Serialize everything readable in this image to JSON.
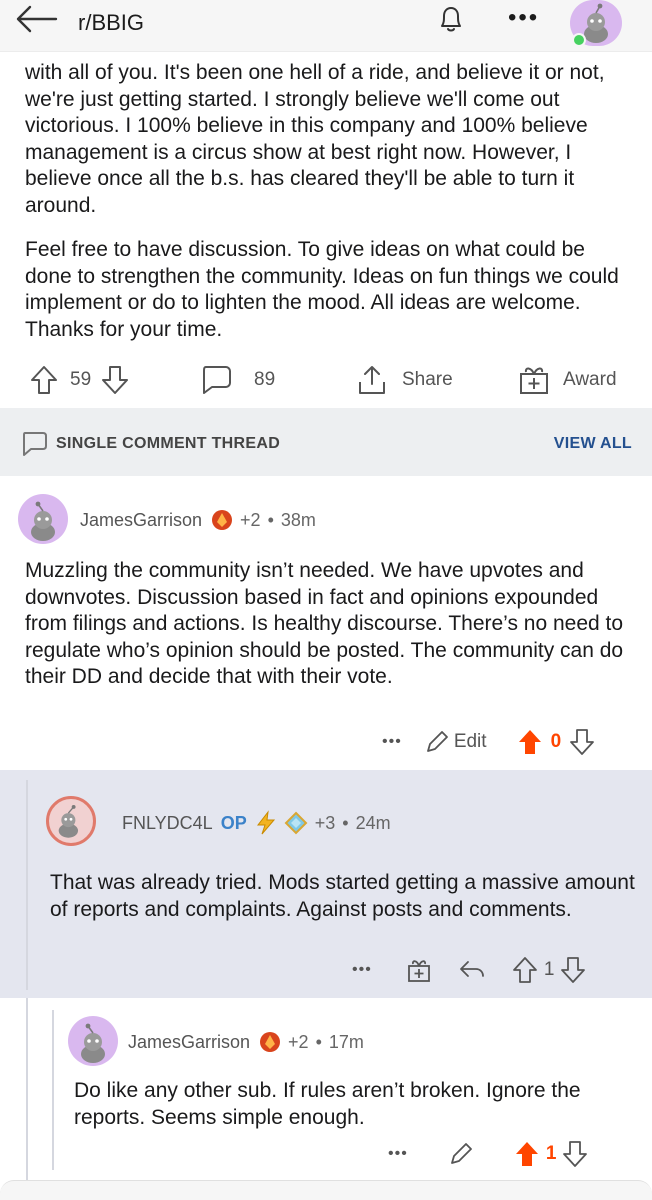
{
  "topbar": {
    "subreddit": "r/BBIG",
    "icons": [
      "back-arrow-icon",
      "bell-icon",
      "more-icon",
      "avatar"
    ],
    "more_label": "•••"
  },
  "post": {
    "paragraphs": [
      "with all of you. It's been one hell of a ride, and believe it or not, we're just getting started. I strongly believe we'll come out victorious. I 100% believe in this company and 100% believe management is a circus show at best right now. However, I believe once all the b.s. has cleared they'll be able to turn it around.",
      "Feel free to have discussion. To give ideas on what could be done to strengthen the community. Ideas on fun things we could implement or do to lighten the mood. All ideas are welcome. Thanks for your time."
    ],
    "votes": "59",
    "comments": "89",
    "share_label": "Share",
    "award_label": "Award"
  },
  "thread": {
    "title": "SINGLE COMMENT THREAD",
    "view_all": "VIEW ALL"
  },
  "comments": [
    {
      "username": "JamesGarrison",
      "award_count": "+2",
      "time": "38m",
      "body": "Muzzling the community isn’t needed. We have upvotes and downvotes. Discussion based in fact and opinions expounded from filings and actions. Is healthy discourse. There’s no need to regulate who’s opinion should be posted. The community can do their DD and decide that with their vote.",
      "more": "•••",
      "edit_label": "Edit",
      "score": "0"
    },
    {
      "username": "FNLYDC4L",
      "op_label": "OP",
      "award_count": "+3",
      "time": "24m",
      "body": "That was already tried. Mods started getting a massive amount of reports and complaints. Against posts and comments.",
      "more": "•••",
      "score": "1"
    },
    {
      "username": "JamesGarrison",
      "award_count": "+2",
      "time": "17m",
      "body": "Do like any other sub. If rules aren’t broken. Ignore the reports. Seems simple enough.",
      "more": "•••",
      "score": "1"
    }
  ],
  "separator": "•",
  "colors": {
    "upvote_active": "#ff4500",
    "op_blue": "#3b82c9",
    "view_all_blue": "#24508f",
    "thread_bg": "#edeff1",
    "reply_bg": "#e4e6ef",
    "avatar_purple": "#d9b8ef",
    "online_green": "#46d160"
  }
}
